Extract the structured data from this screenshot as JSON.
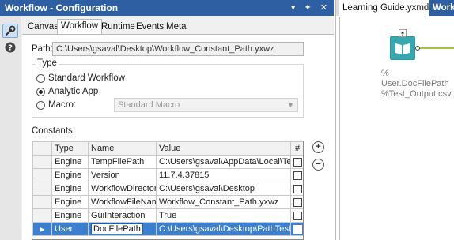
{
  "panel": {
    "title": "Workflow - Configuration",
    "title_controls": "▾ ✦ ✕"
  },
  "toolstrip": {
    "icons": [
      "wrench-icon",
      "help-icon"
    ]
  },
  "tabs": [
    {
      "label": "Canvas",
      "active": false
    },
    {
      "label": "Workflow",
      "active": true
    },
    {
      "label": "Runtime",
      "active": false
    },
    {
      "label": "Events",
      "active": false
    },
    {
      "label": "Meta Info",
      "active": false
    }
  ],
  "path": {
    "label": "Path:",
    "value": "C:\\Users\\gsaval\\Desktop\\Workflow_Constant_Path.yxwz"
  },
  "type_group": {
    "legend": "Type",
    "options": [
      {
        "label": "Standard Workflow",
        "selected": false
      },
      {
        "label": "Analytic App",
        "selected": true
      },
      {
        "label": "Macro:",
        "selected": false
      }
    ],
    "macro_select": {
      "value": "Standard Macro",
      "disabled": true
    }
  },
  "constants": {
    "label": "Constants:",
    "columns": [
      "Type",
      "Name",
      "Value",
      "#"
    ],
    "rows": [
      {
        "type": "Engine",
        "name": "TempFilePath",
        "value": "C:\\Users\\gsaval\\AppData\\Local\\Temp\\",
        "numeric": false,
        "selected": false
      },
      {
        "type": "Engine",
        "name": "Version",
        "value": "11.7.4.37815",
        "numeric": false,
        "selected": false
      },
      {
        "type": "Engine",
        "name": "WorkflowDirectory",
        "value": "C:\\Users\\gsaval\\Desktop",
        "numeric": false,
        "selected": false
      },
      {
        "type": "Engine",
        "name": "WorkflowFileName",
        "value": "Workflow_Constant_Path.yxwz",
        "numeric": false,
        "selected": false
      },
      {
        "type": "Engine",
        "name": "GuiInteraction",
        "value": "True",
        "numeric": false,
        "selected": false
      },
      {
        "type": "User",
        "name": "DocFilePath",
        "value": "C:\\Users\\gsaval\\Desktop\\PathTest\\",
        "numeric": false,
        "selected": true
      }
    ],
    "add_button": "+",
    "remove_button": "−",
    "current_row_marker": "▶"
  },
  "right": {
    "tabs": [
      {
        "label": "Learning Guide.yxmd",
        "close": "✕"
      },
      {
        "label": "Work",
        "close": ""
      }
    ],
    "tool_annotation": [
      "%",
      "User.DocFilePath",
      "%Test_Output.csv"
    ],
    "colors": {
      "tool_border": "#2a9aa3",
      "tool_fill": "#3aa6b0"
    }
  },
  "colors": {
    "titlebar": "#2f5fa3",
    "selected_row": "#3a7fd0"
  }
}
